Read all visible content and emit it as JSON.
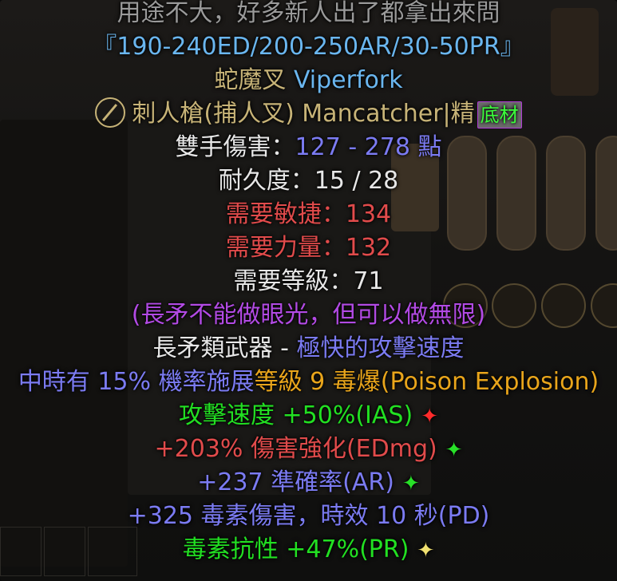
{
  "tooltip": {
    "note": "用途不大，好多新人出了都拿出來問",
    "ranges": "『190-240ED/200-250AR/30-50PR』",
    "unique_cn": "蛇魔叉",
    "unique_en": "Viperfork",
    "base_name": "刺人槍(捕人叉) Mancatcher|精",
    "base_badge": "底材",
    "damage_label": "雙手傷害：",
    "damage_value": "127 - 278 點",
    "durability": "耐久度：15 / 28",
    "req_dex": "需要敏捷：134",
    "req_str": "需要力量：132",
    "req_level": "需要等級：71",
    "remark": "(長矛不能做眼光，但可以做無限)",
    "class_label": "長矛類武器 - ",
    "class_speed": "極快的攻擊速度",
    "proc_prefix": "中時有 15% 機率施展",
    "proc_level": "等級 9 毒爆",
    "proc_skill": "(Poison Explosion)",
    "ias": "攻擊速度 +50%(IAS)",
    "edmg": "+203% 傷害強化(EDmg)",
    "ar": "+237 準確率(AR)",
    "pd": "+325 毒素傷害，時效 10 秒(PD)",
    "pr": "毒素抗性 +47%(PR)"
  },
  "stars": {
    "ias": "✦",
    "edmg": "✦",
    "ar": "✦",
    "pr": "✦"
  },
  "colors": {
    "ias_star": "#ff2b2b",
    "edmg_star": "#28e028",
    "ar_star": "#28e028",
    "pr_star": "#f0e070"
  }
}
